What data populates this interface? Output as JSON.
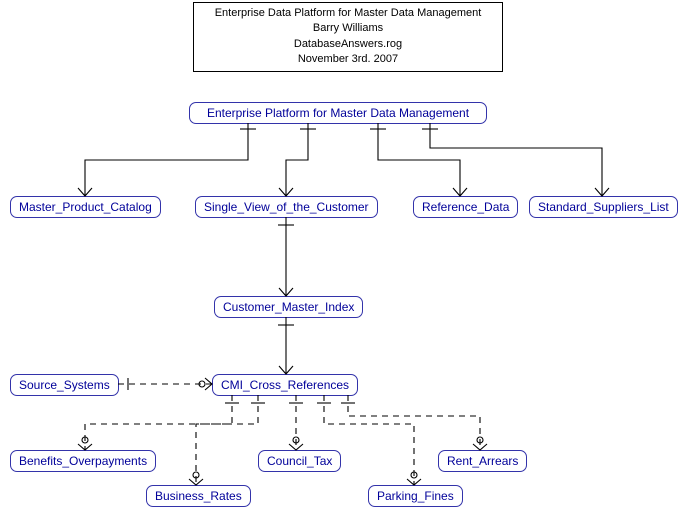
{
  "title": {
    "line1": "Enterprise Data Platform for Master Data Management",
    "line2": "Barry Williams",
    "line3": "DatabaseAnswers.rog",
    "line4": "November 3rd. 2007"
  },
  "entities": {
    "root": "Enterprise Platform for Master Data Management",
    "master_product_catalog": "Master_Product_Catalog",
    "single_view_customer": "Single_View_of_the_Customer",
    "reference_data": "Reference_Data",
    "standard_suppliers": "Standard_Suppliers_List",
    "customer_master_index": "Customer_Master_Index",
    "source_systems": "Source_Systems",
    "cmi_cross_references": "CMI_Cross_References",
    "benefits_overpayments": "Benefits_Overpayments",
    "business_rates": "Business_Rates",
    "council_tax": "Council_Tax",
    "parking_fines": "Parking_Fines",
    "rent_arrears": "Rent_Arrears"
  }
}
